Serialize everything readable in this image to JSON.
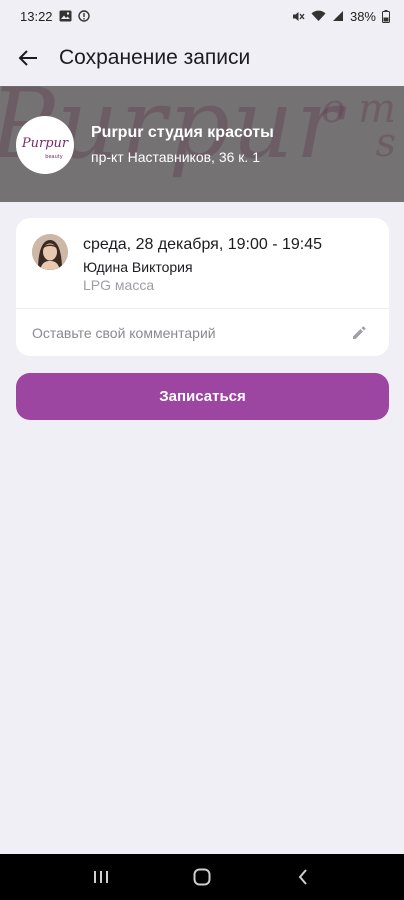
{
  "status_bar": {
    "time": "13:22",
    "battery": "38%",
    "icons": [
      "gallery-icon",
      "alert-circle-icon",
      "mute-icon",
      "wifi-icon",
      "signal-icon",
      "battery-icon"
    ]
  },
  "app_bar": {
    "title": "Сохранение записи",
    "back_icon": "arrow-left-icon"
  },
  "salon": {
    "name": "Purpur студия красоты",
    "address": "пр-кт Наставников, 36 к. 1",
    "logo_text": "Purpur",
    "logo_subtext": "beauty"
  },
  "appointment": {
    "datetime": "среда, 28 декабря, 19:00 - 19:45",
    "master": "Юдина Виктория",
    "service": "LPG масса",
    "comment_placeholder": "Оставьте свой комментарий"
  },
  "actions": {
    "book_label": "Записаться"
  },
  "nav_bar": {
    "icons": [
      "recent-apps-icon",
      "home-icon",
      "back-icon"
    ]
  },
  "colors": {
    "accent": "#9c46a2",
    "background": "#f0eff5",
    "card": "#ffffff",
    "muted_text": "#9e9ea4"
  }
}
